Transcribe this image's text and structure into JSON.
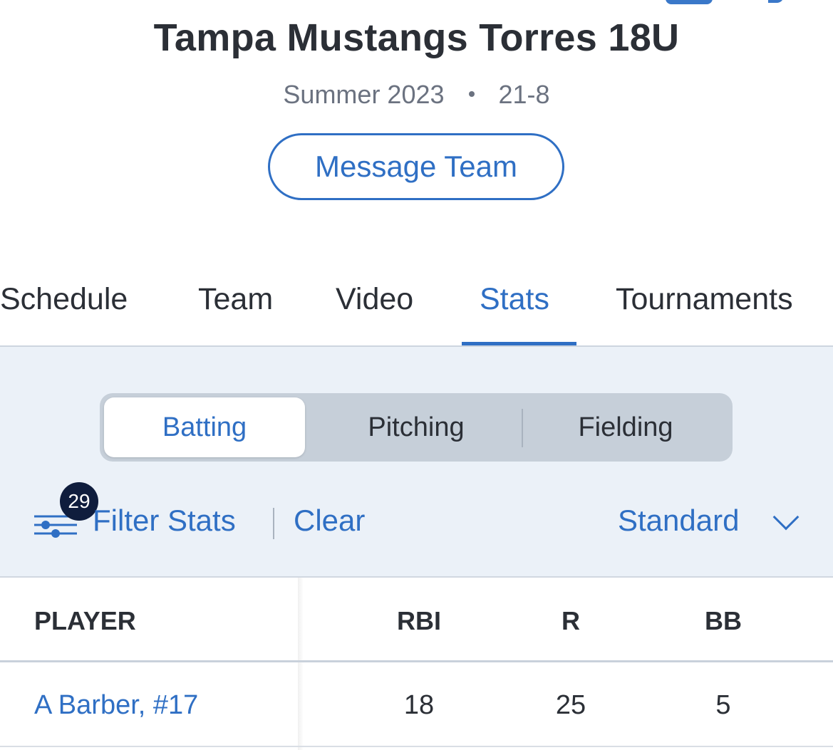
{
  "team": {
    "name": "Tampa Mustangs Torres 18U",
    "season": "Summer 2023",
    "record": "21-8",
    "message_button": "Message Team"
  },
  "tabs": [
    {
      "label": "Schedule",
      "active": false
    },
    {
      "label": "Team",
      "active": false
    },
    {
      "label": "Video",
      "active": false
    },
    {
      "label": "Stats",
      "active": true
    },
    {
      "label": "Tournaments",
      "active": false
    }
  ],
  "stats": {
    "segments": [
      {
        "label": "Batting",
        "active": true
      },
      {
        "label": "Pitching",
        "active": false
      },
      {
        "label": "Fielding",
        "active": false
      }
    ],
    "filter": {
      "badge_count": "29",
      "label": "Filter Stats",
      "clear": "Clear",
      "view_select": "Standard"
    },
    "table": {
      "columns": [
        "PLAYER",
        "RBI",
        "R",
        "BB"
      ],
      "rows": [
        {
          "player": "A Barber, #17",
          "rbi": "18",
          "r": "25",
          "bb": "5"
        }
      ]
    }
  },
  "colors": {
    "accent": "#2f6fc4",
    "text": "#2b2f36",
    "muted": "#6b7280",
    "panel_bg": "#ebf1f8",
    "segment_bg": "#c6cfd9",
    "badge_bg": "#0f1d3d"
  }
}
